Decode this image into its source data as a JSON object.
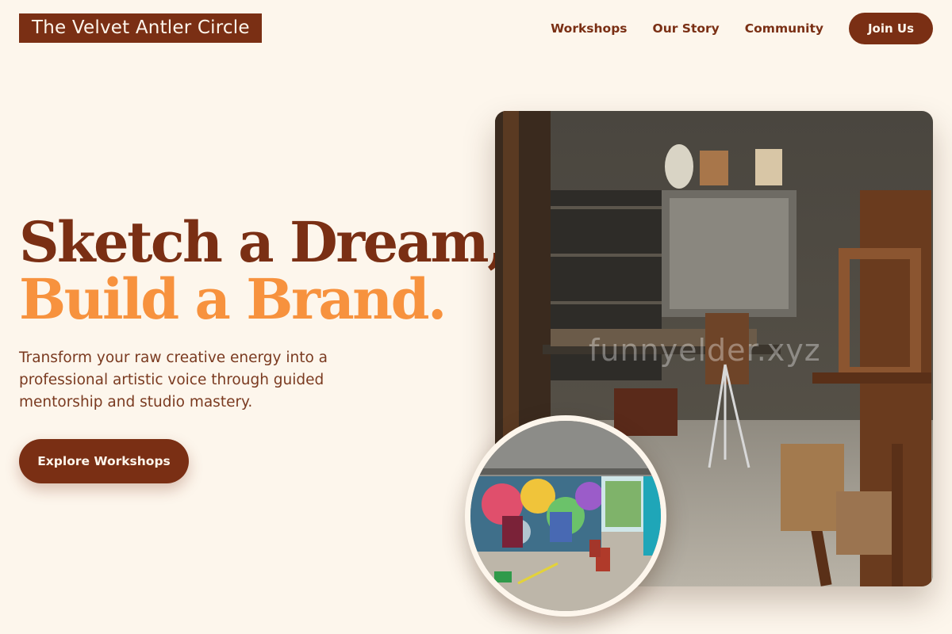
{
  "brand": {
    "name": "The Velvet Antler Circle"
  },
  "nav": {
    "links": [
      "Workshops",
      "Our Story",
      "Community"
    ],
    "cta_label": "Join Us"
  },
  "hero": {
    "headline_line1": "Sketch a Dream,",
    "headline_line2": "Build a Brand.",
    "subtext": "Transform your raw creative energy into a professional artistic voice through guided mentorship and studio mastery.",
    "cta_label": "Explore Workshops"
  },
  "images": {
    "main_watermark": "funnyelder.xyz"
  },
  "colors": {
    "background": "#fdf6ec",
    "brand_brown": "#7a2f14",
    "accent_orange": "#f7923e"
  }
}
